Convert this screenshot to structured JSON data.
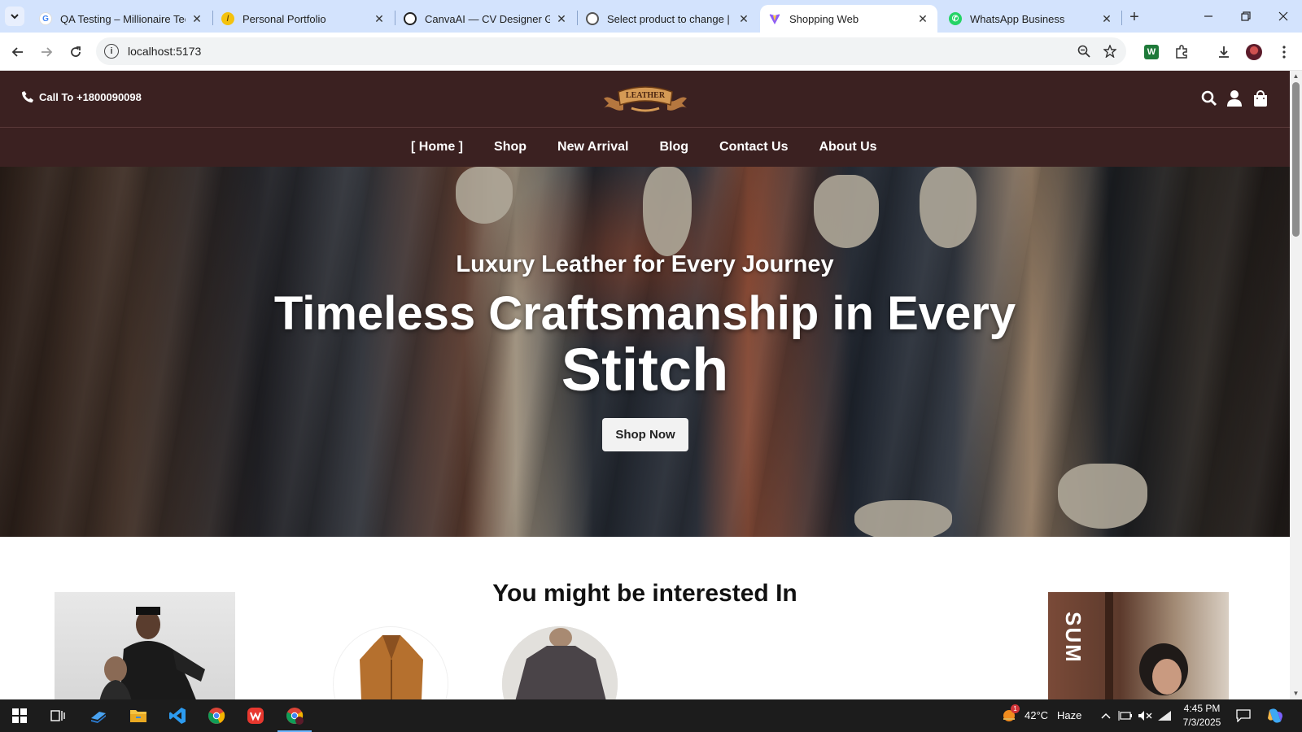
{
  "browser": {
    "tabs": [
      {
        "title": "QA Testing – Millionaire Tech",
        "favicon": "google-icon"
      },
      {
        "title": "Personal Portfolio",
        "favicon": "portfolio-icon"
      },
      {
        "title": "CanvaAI — CV Designer GPT",
        "favicon": "openai-icon"
      },
      {
        "title": "Select product to change | D",
        "favicon": "globe-icon"
      },
      {
        "title": "Shopping Web",
        "favicon": "vite-icon",
        "active": true
      },
      {
        "title": "WhatsApp Business",
        "favicon": "whatsapp-icon"
      }
    ],
    "url": "localhost:5173"
  },
  "site": {
    "call_text": "Call To +1800090098",
    "logo_text": "LEATHER",
    "nav": [
      "Home",
      "Shop",
      "New Arrival",
      "Blog",
      "Contact Us",
      "About Us"
    ],
    "active_nav": "Home"
  },
  "hero": {
    "subtitle": "Luxury Leather for Every Journey",
    "title_line1": "Timeless Craftsmanship in Every",
    "title_line2": "Stitch",
    "cta": "Shop Now"
  },
  "section": {
    "title": "You might be interested In",
    "promo_right_text": "SUM"
  },
  "taskbar": {
    "temperature": "42°C",
    "weather": "Haze",
    "weather_badge": "1",
    "time": "4:45 PM",
    "date": "7/3/2025"
  },
  "colors": {
    "header_bg": "#3b2121",
    "tabbar_bg": "#d3e3fd",
    "taskbar_bg": "#1c1c1c"
  }
}
